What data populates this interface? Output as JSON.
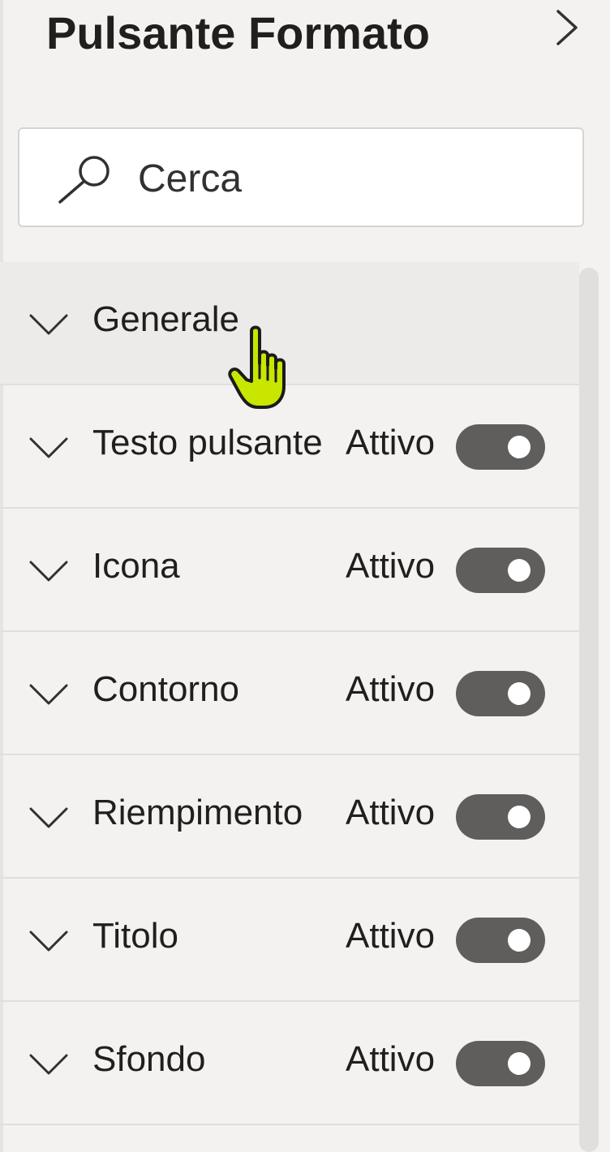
{
  "header": {
    "title": "Pulsante Formato",
    "collapse_icon": "chevron-right-icon"
  },
  "search": {
    "placeholder": "Cerca",
    "value": "",
    "icon": "search-icon"
  },
  "sections": [
    {
      "label": "Generale",
      "has_toggle": false
    },
    {
      "label": "Testo pulsante",
      "state": "Attivo",
      "on": true
    },
    {
      "label": "Icona",
      "state": "Attivo",
      "on": true
    },
    {
      "label": "Contorno",
      "state": "Attivo",
      "on": true
    },
    {
      "label": "Riempimento",
      "state": "Attivo",
      "on": true
    },
    {
      "label": "Titolo",
      "state": "Attivo",
      "on": true
    },
    {
      "label": "Sfondo",
      "state": "Attivo",
      "on": true
    }
  ],
  "colors": {
    "panel_background": "#f3f2f1",
    "toggle_on": "#605e5c",
    "cursor_highlight": "#c8e600"
  }
}
